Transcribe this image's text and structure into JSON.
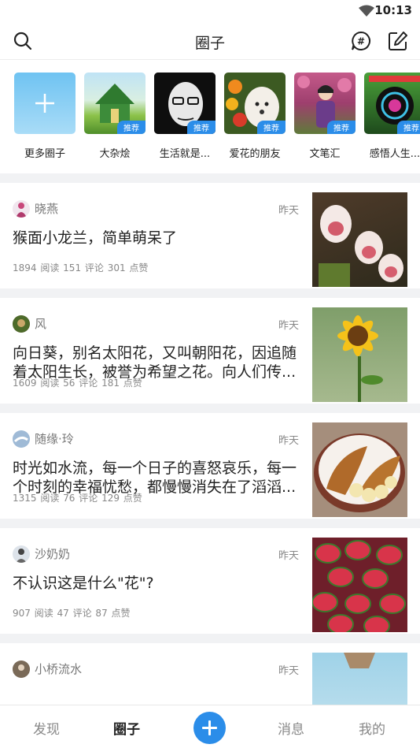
{
  "status_bar": {
    "time": "10:13"
  },
  "header": {
    "title": "圈子"
  },
  "circles": [
    {
      "label": "更多圈子",
      "badge": ""
    },
    {
      "label": "大杂烩",
      "badge": "推荐"
    },
    {
      "label": "生活就是...",
      "badge": "推荐"
    },
    {
      "label": "爱花的朋友",
      "badge": "推荐"
    },
    {
      "label": "文笔汇",
      "badge": "推荐"
    },
    {
      "label": "感悟人生...",
      "badge": "推荐"
    }
  ],
  "posts": [
    {
      "author": "晓燕",
      "time": "昨天",
      "text": "猴面小龙兰，简单萌呆了",
      "stats": "1894 阅读  151 评论  301 点赞"
    },
    {
      "author": "风",
      "time": "昨天",
      "text": "向日葵，别名太阳花，又叫朝阳花，因追随着太阳生长，被誉为希望之花。向人们传...",
      "stats": "1609 阅读  56 评论  181 点赞"
    },
    {
      "author": "随缘·玲",
      "time": "昨天",
      "text": "时光如水流，每一个日子的喜怒哀乐，每一个时刻的幸福忧愁，都慢慢消失在了滔滔...",
      "stats": "1315 阅读  76 评论  129 点赞"
    },
    {
      "author": "沙奶奶",
      "time": "昨天",
      "text": "不认识这是什么\"花\"?",
      "stats": "907 阅读  47 评论  87 点赞"
    },
    {
      "author": "小桥流水",
      "time": "昨天",
      "text": "",
      "stats": ""
    }
  ],
  "tabbar": {
    "discover": "发现",
    "circles": "圈子",
    "messages": "消息",
    "mine": "我的"
  }
}
